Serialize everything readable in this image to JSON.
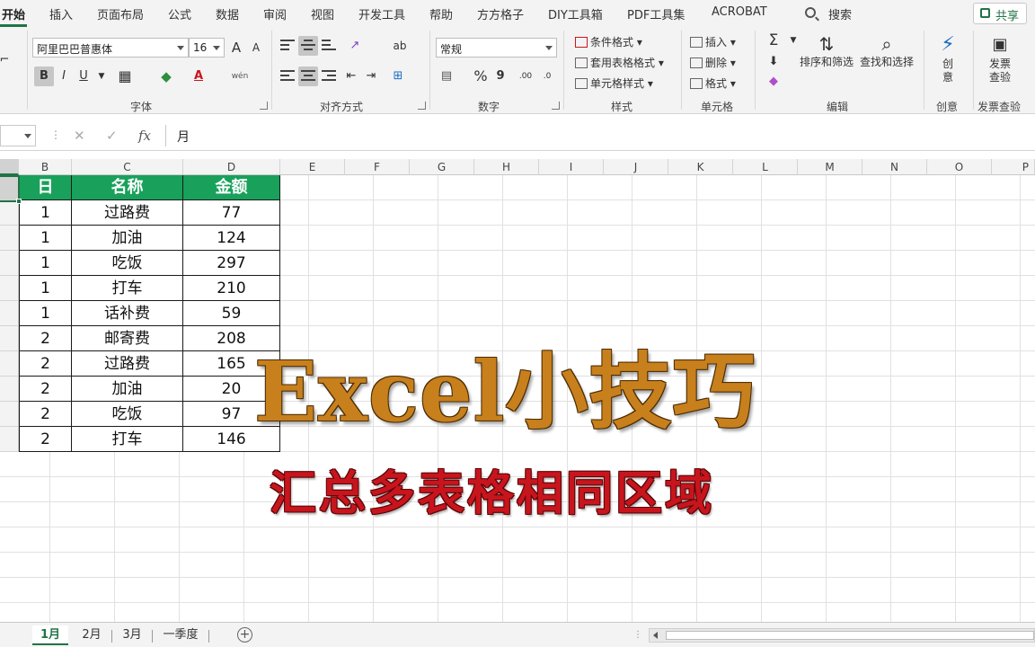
{
  "menu": {
    "tabs": [
      "开始",
      "插入",
      "页面布局",
      "公式",
      "数据",
      "审阅",
      "视图",
      "开发工具",
      "帮助",
      "方方格子",
      "DIY工具箱",
      "PDF工具集",
      "ACROBAT"
    ],
    "search_label": "搜索",
    "share_label": "共享"
  },
  "ribbon": {
    "font": {
      "name": "阿里巴巴普惠体",
      "size": "16",
      "grow": "A",
      "shrink": "A",
      "bold": "B",
      "italic": "I",
      "underline": "U",
      "color_letter": "A",
      "phonetic": "wén",
      "label": "字体"
    },
    "alignment": {
      "label": "对齐方式"
    },
    "number": {
      "format": "常规",
      "percent": "%",
      "comma": "9",
      "label": "数字"
    },
    "styles": {
      "conditional": "条件格式",
      "table": "套用表格格式",
      "cell": "单元格样式",
      "label": "样式"
    },
    "cells": {
      "insert": "插入",
      "delete": "删除",
      "format": "格式",
      "label": "单元格"
    },
    "editing": {
      "sum": "Σ",
      "sort": "排序和筛选",
      "find": "查找和选择",
      "label": "编辑"
    },
    "creative": {
      "button": "创意",
      "label": "创意"
    },
    "invoice": {
      "button": "发票查验",
      "label": "发票查验"
    }
  },
  "formula_bar": {
    "cancel": "✕",
    "enter": "✓",
    "fx": "fx",
    "value": "月"
  },
  "columns": [
    "B",
    "C",
    "D",
    "E",
    "F",
    "G",
    "H",
    "I",
    "J",
    "K",
    "L",
    "M",
    "N",
    "O",
    "P"
  ],
  "table": {
    "headers": [
      "日",
      "名称",
      "金额"
    ],
    "rows": [
      [
        "1",
        "过路费",
        "77"
      ],
      [
        "1",
        "加油",
        "124"
      ],
      [
        "1",
        "吃饭",
        "297"
      ],
      [
        "1",
        "打车",
        "210"
      ],
      [
        "1",
        "话补费",
        "59"
      ],
      [
        "2",
        "邮寄费",
        "208"
      ],
      [
        "2",
        "过路费",
        "165"
      ],
      [
        "2",
        "加油",
        "20"
      ],
      [
        "2",
        "吃饭",
        "97"
      ],
      [
        "2",
        "打车",
        "146"
      ]
    ]
  },
  "overlay": {
    "title": "Excel小技巧",
    "subtitle": "汇总多表格相同区域"
  },
  "sheets": {
    "tabs": [
      "1月",
      "2月",
      "3月",
      "一季度"
    ],
    "active_index": 0
  },
  "colors": {
    "accent": "#217346",
    "header_fill": "#19a15b",
    "title": "#c8801c",
    "subtitle": "#c8151d"
  }
}
